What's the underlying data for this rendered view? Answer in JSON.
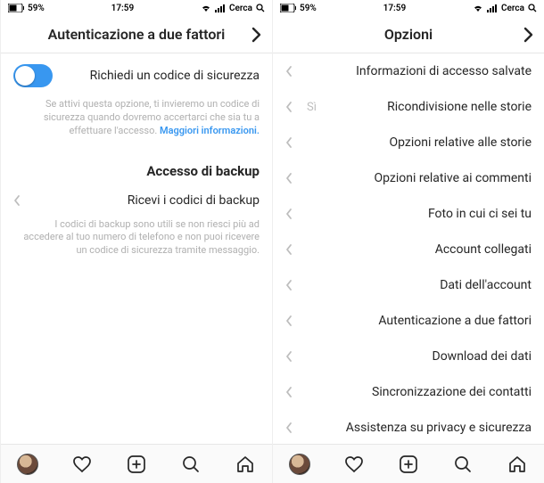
{
  "status": {
    "battery": "59%",
    "time": "17:59",
    "search": "Cerca"
  },
  "right_screen": {
    "title": "Opzioni",
    "items": [
      {
        "label": "Informazioni di accesso salvate"
      },
      {
        "label": "Ricondivisione nelle storie",
        "value": "Sì"
      },
      {
        "label": "Opzioni relative alle storie"
      },
      {
        "label": "Opzioni relative ai commenti"
      },
      {
        "label": "Foto in cui ci sei tu"
      },
      {
        "label": "Account collegati"
      },
      {
        "label": "Dati dell'account"
      },
      {
        "label": "Autenticazione a due fattori"
      },
      {
        "label": "Download dei dati"
      },
      {
        "label": "Sincronizzazione dei contatti"
      },
      {
        "label": "Assistenza su privacy e sicurezza"
      }
    ]
  },
  "left_screen": {
    "title": "Autenticazione a due fattori",
    "toggle_label": "Richiedi un codice di sicurezza",
    "toggle_helper": "Se attivi questa opzione, ti invieremo un codice di sicurezza quando dovremo accertarci che sia tu a effettuare l'accesso.",
    "toggle_helper_link": "Maggiori informazioni.",
    "section": "Accesso di backup",
    "backup_label": "Ricevi i codici di backup",
    "backup_helper": "I codici di backup sono utili se non riesci più ad accedere al tuo numero di telefono e non puoi ricevere un codice di sicurezza tramite messaggio."
  }
}
